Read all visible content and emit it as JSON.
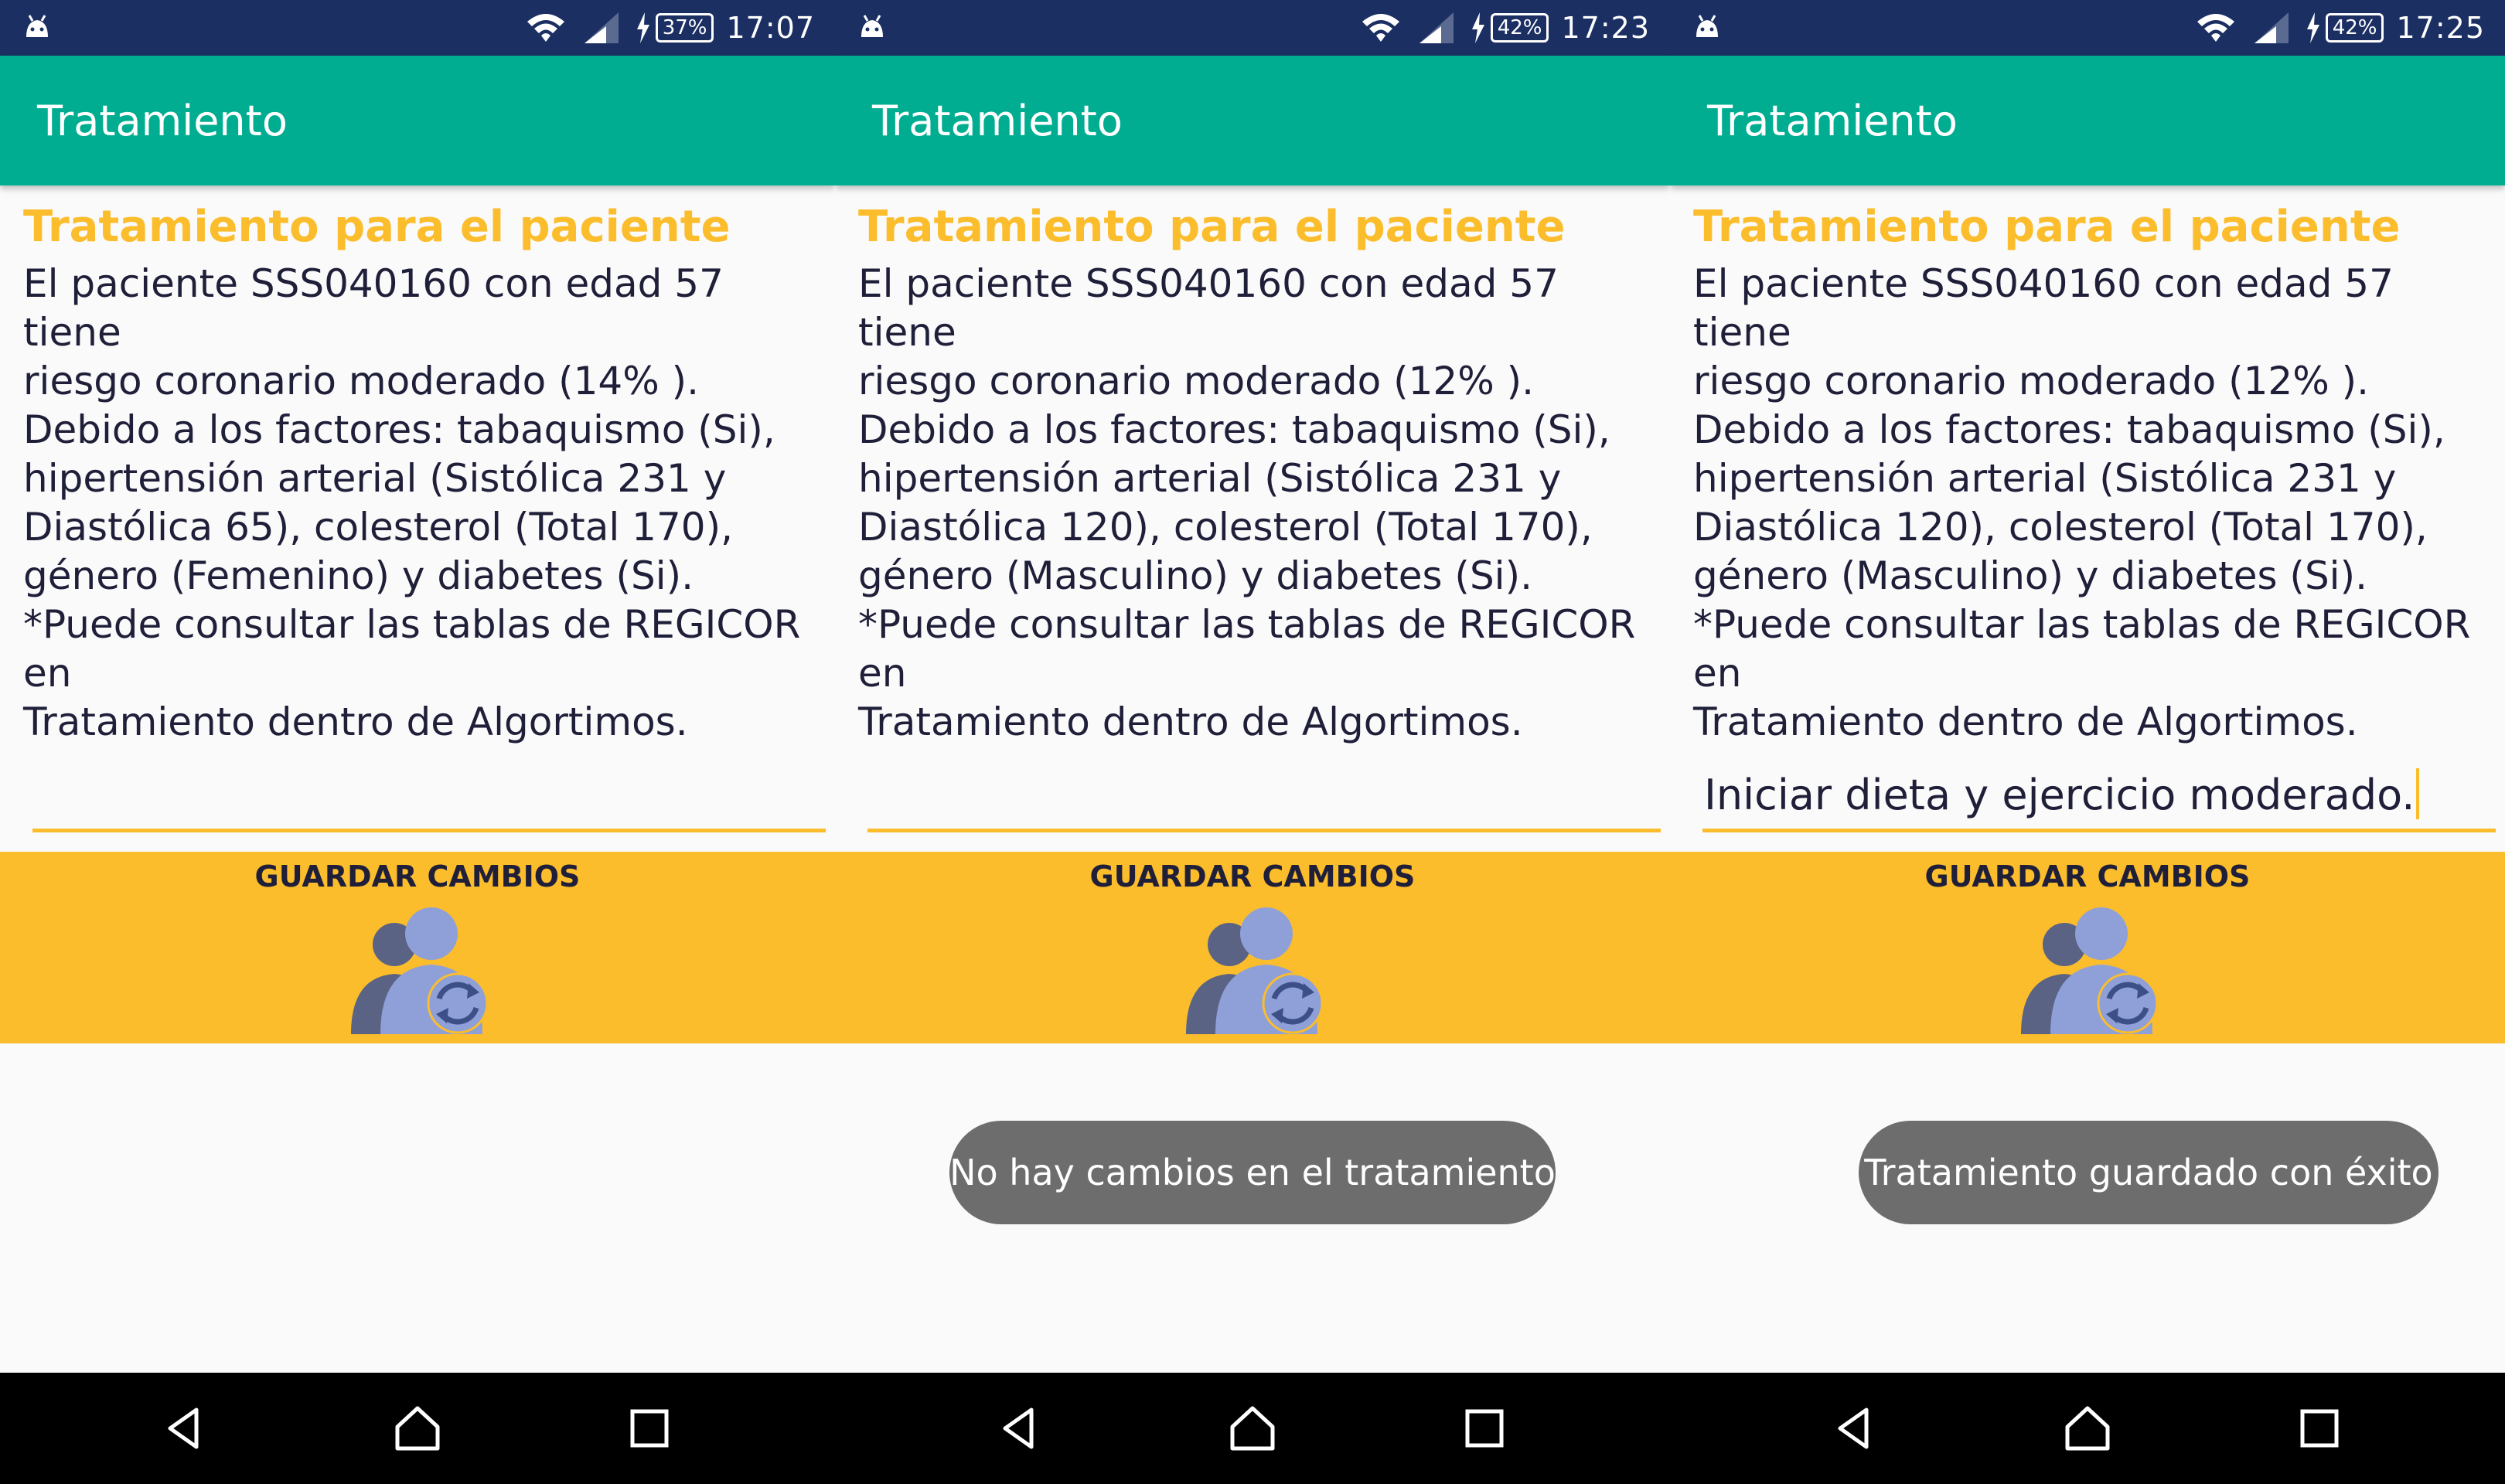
{
  "screens": [
    {
      "status": {
        "battery": "37%",
        "time": "17:07"
      },
      "appbar": {
        "title": "Tratamiento"
      },
      "card": {
        "title": "Tratamiento para el paciente",
        "lines": [
          "El paciente SSS040160 con edad 57 tiene",
          "riesgo coronario moderado (14% ).",
          "Debido a los factores: tabaquismo (Si),",
          "hipertensión arterial (Sistólica 231 y",
          "Diastólica 65), colesterol (Total 170),",
          "género (Femenino) y diabetes (Si).",
          "*Puede consultar las tablas de REGICOR en",
          "Tratamiento dentro de Algortimos."
        ]
      },
      "field": {
        "value": ""
      },
      "save_label": "GUARDAR CAMBIOS",
      "toast": ""
    },
    {
      "status": {
        "battery": "42%",
        "time": "17:23"
      },
      "appbar": {
        "title": "Tratamiento"
      },
      "card": {
        "title": "Tratamiento para el paciente",
        "lines": [
          "El paciente SSS040160 con edad 57 tiene",
          "riesgo coronario moderado (12% ).",
          "Debido a los factores: tabaquismo (Si),",
          "hipertensión arterial (Sistólica 231 y",
          "Diastólica 120), colesterol (Total 170),",
          "género (Masculino) y diabetes (Si).",
          "*Puede consultar las tablas de REGICOR en",
          "Tratamiento dentro de Algortimos."
        ]
      },
      "field": {
        "value": ""
      },
      "save_label": "GUARDAR CAMBIOS",
      "toast": "No hay cambios en el tratamiento"
    },
    {
      "status": {
        "battery": "42%",
        "time": "17:25"
      },
      "appbar": {
        "title": "Tratamiento"
      },
      "card": {
        "title": "Tratamiento para el paciente",
        "lines": [
          "El paciente SSS040160 con edad 57 tiene",
          "riesgo coronario moderado (12% ).",
          "Debido a los factores: tabaquismo (Si),",
          "hipertensión arterial (Sistólica 231 y",
          "Diastólica 120), colesterol (Total 170),",
          "género (Masculino) y diabetes (Si).",
          "*Puede consultar las tablas de REGICOR en",
          "Tratamiento dentro de Algortimos."
        ]
      },
      "field": {
        "value": "Iniciar dieta y ejercicio moderado."
      },
      "save_label": "GUARDAR CAMBIOS",
      "toast": "Tratamiento guardado con éxito"
    }
  ],
  "colors": {
    "status_bar": "#1b2f63",
    "app_bar": "#00ad91",
    "accent": "#fbbd2c",
    "toast": "#6d6d6d",
    "nav_bar": "#000000"
  },
  "icons": {
    "status_left": "android-icon",
    "wifi": "wifi-icon",
    "signal": "signal-icon",
    "charging": "charging-icon",
    "save": "users-sync-icon",
    "nav": [
      "back-icon",
      "home-icon",
      "recents-icon"
    ]
  }
}
